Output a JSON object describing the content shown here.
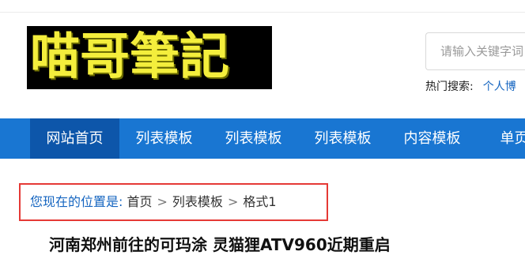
{
  "logo": {
    "text": "喵哥筆記"
  },
  "search": {
    "placeholder": "请输入关键字词",
    "hot_label": "热门搜索:",
    "hot_link": "个人博"
  },
  "nav": {
    "items": [
      "网站首页",
      "列表模板",
      "列表模板",
      "列表模板",
      "内容模板",
      "单页模"
    ],
    "active_index": 0
  },
  "breadcrumb": {
    "label": "您现在的位置是:",
    "items": [
      "首页",
      "列表模板",
      "格式1"
    ],
    "separator": ">"
  },
  "article": {
    "title": "河南郑州前往的可玛涂 灵猫狸ATV960近期重启"
  },
  "colors": {
    "nav_bg": "#1976d2",
    "nav_active": "#0d56aa",
    "link": "#1565c0",
    "highlight": "#e53935"
  }
}
